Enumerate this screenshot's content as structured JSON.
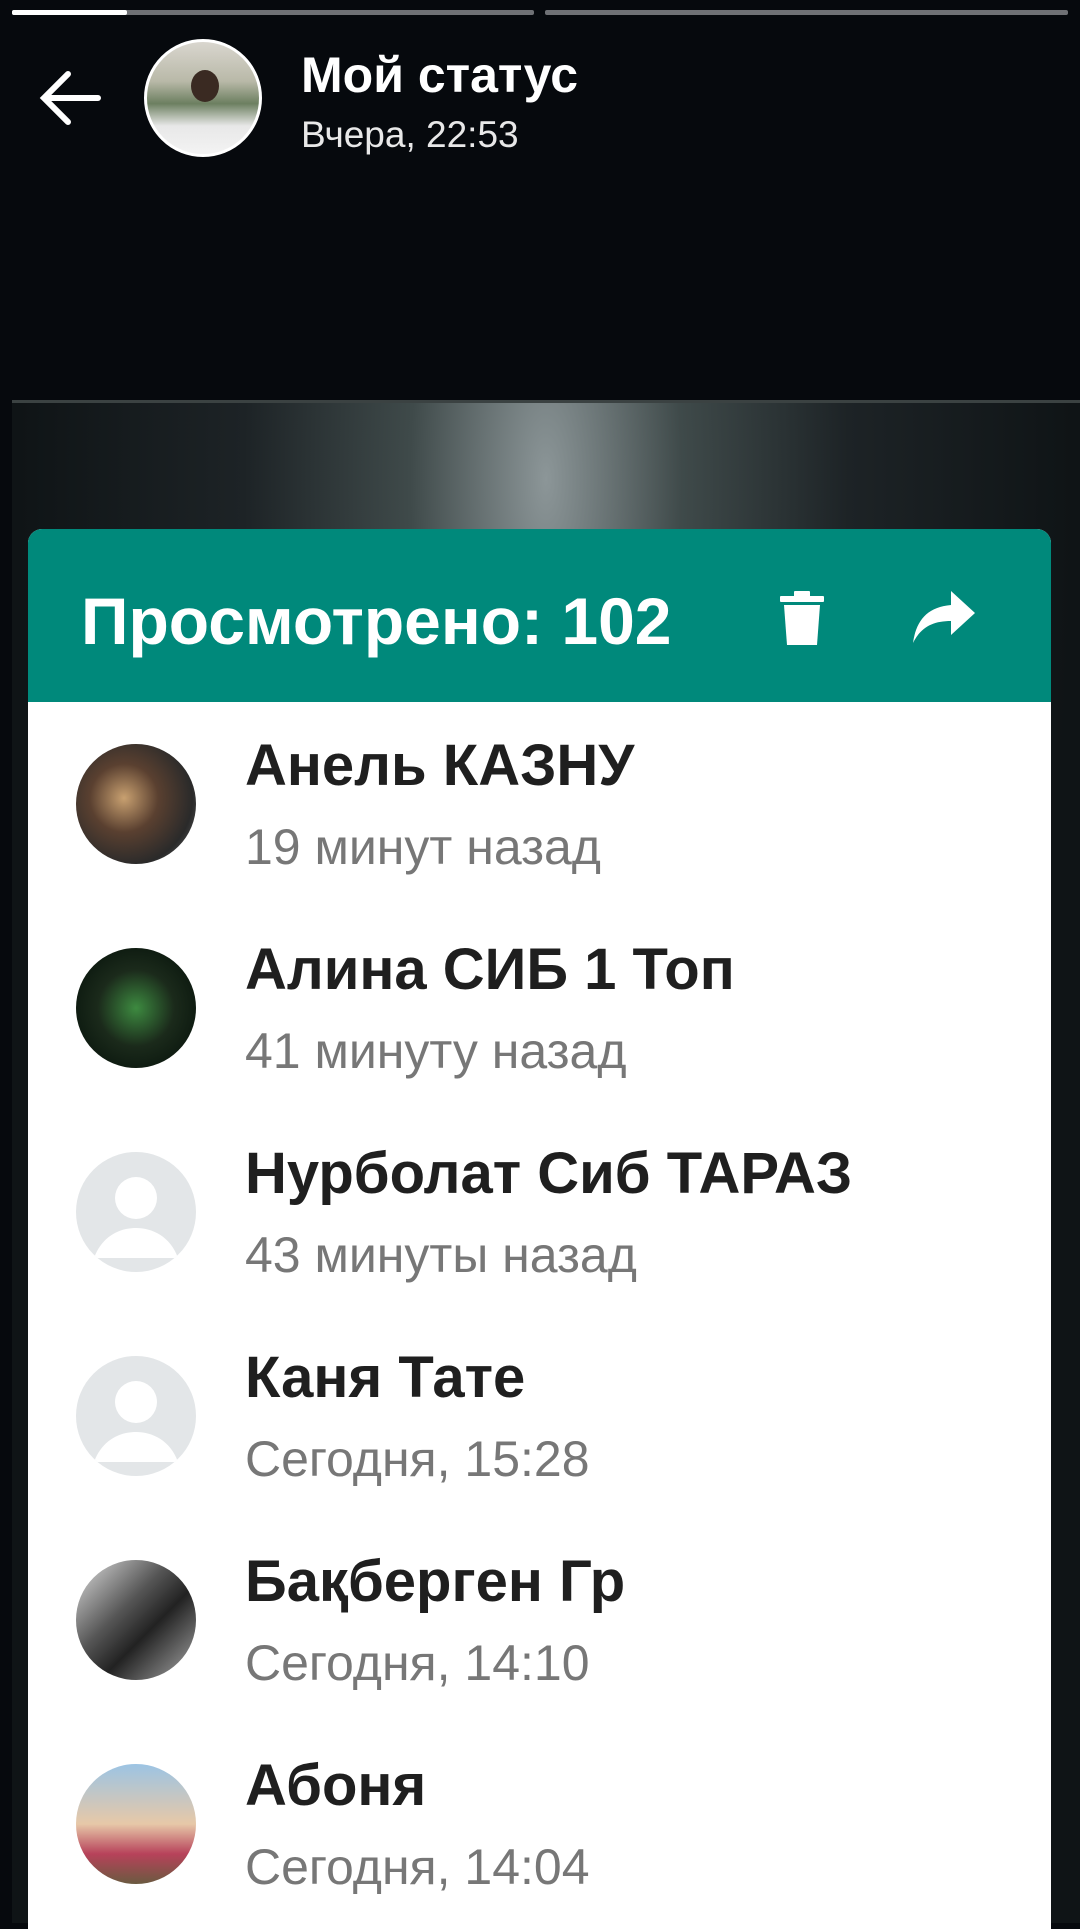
{
  "status_progress": {
    "segments": 2,
    "current_segment_fraction": 0.22
  },
  "header": {
    "title": "Мой статус",
    "subtitle": "Вчера, 22:53"
  },
  "viewers_panel": {
    "title": "Просмотрено: 102",
    "accent_color": "#00897b",
    "viewers": [
      {
        "name": "Анель КАЗНУ",
        "time": "19 минут назад",
        "avatar": "photo"
      },
      {
        "name": "Алина СИБ 1 Топ",
        "time": "41 минуту назад",
        "avatar": "photo"
      },
      {
        "name": "Нурболат Сиб ТАРАЗ",
        "time": "43 минуты назад",
        "avatar": "default"
      },
      {
        "name": "Каня Тате",
        "time": "Сегодня, 15:28",
        "avatar": "default"
      },
      {
        "name": "Бақберген Гр",
        "time": "Сегодня, 14:10",
        "avatar": "photo"
      },
      {
        "name": "Абоня",
        "time": "Сегодня, 14:04",
        "avatar": "photo"
      }
    ]
  }
}
